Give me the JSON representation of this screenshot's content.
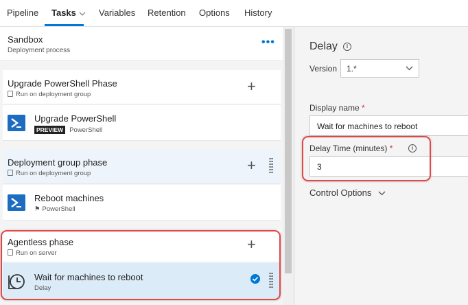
{
  "tabs": [
    {
      "label": "Pipeline"
    },
    {
      "label": "Tasks"
    },
    {
      "label": "Variables"
    },
    {
      "label": "Retention"
    },
    {
      "label": "Options"
    },
    {
      "label": "History"
    }
  ],
  "environment": {
    "title": "Sandbox",
    "subtitle": "Deployment process",
    "more_label": "•••"
  },
  "phases": [
    {
      "title": "Upgrade PowerShell Phase",
      "subtitle": "Run on deployment group",
      "tasks": [
        {
          "title": "Upgrade PowerShell",
          "badge": "PREVIEW",
          "subtitle": "PowerShell"
        }
      ]
    },
    {
      "title": "Deployment group phase",
      "subtitle": "Run on deployment group",
      "tasks": [
        {
          "title": "Reboot machines",
          "subtitle": "PowerShell"
        }
      ]
    },
    {
      "title": "Agentless phase",
      "subtitle": "Run on server",
      "tasks": [
        {
          "title": "Wait for machines to reboot",
          "subtitle": "Delay",
          "selected": true
        }
      ]
    }
  ],
  "details": {
    "title": "Delay",
    "version_label": "Version",
    "version_value": "1.*",
    "display_name_label": "Display name",
    "display_name_value": "Wait for machines to reboot",
    "delay_label": "Delay Time (minutes)",
    "delay_value": "3",
    "required_mark": "*",
    "control_options_label": "Control Options"
  },
  "colors": {
    "accent": "#0078d4",
    "highlight": "#e04848",
    "selected_row": "#dcebf8"
  }
}
